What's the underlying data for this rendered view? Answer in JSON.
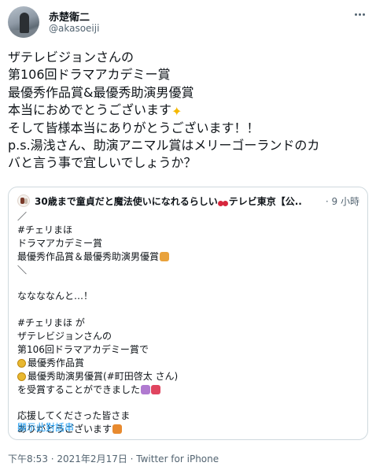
{
  "tweet": {
    "author_name": "赤楚衛二",
    "author_handle": "@akasoeiji",
    "text_lines": [
      "ザテレビジョンさんの",
      "第106回ドラマアカデミー賞",
      "最優秀作品賞&最優秀助演男優賞",
      "本当におめでとうございます",
      "そして皆様本当にありがとうございます！！",
      "p.s.湯浅さん、助演アニマル賞はメリーゴーランドのカ",
      "バと言う事で宜しいでしょうか？"
    ],
    "footer": "下午8:53 · 2021年2月17日 · Twitter for iPhone"
  },
  "quote": {
    "title_prefix": "30歳まで童貞だと魔法使いになれるらしい",
    "title_suffix": "テレビ東京【公...",
    "time": "· 9 小時",
    "lines": [
      "／",
      "#チェリまほ",
      "ドラマアカデミー賞",
      "最優秀作品賞＆最優秀助演男優賞",
      "＼",
      "",
      "ななななんと…！",
      "",
      "#チェリまほ が",
      "ザテレビジョンさんの",
      "第106回ドラマアカデミー賞で",
      "最優秀作品賞",
      "最優秀助演男優賞(#町田啓太 さん)",
      "を受賞することができました",
      "",
      "応援してくださった皆さま",
      "ありがとうございます"
    ],
    "show_thread": "顯示此對話串"
  },
  "icons": {
    "more": "more-horizontal-icon",
    "cherry": "cherry-emoji-icon",
    "sparkles": "sparkles-emoji-icon",
    "medal": "medal-emoji-icon",
    "party": "party-popper-emoji-icon",
    "bouquet": "bouquet-emoji-icon",
    "cheer": "cheering-emoji-icon"
  },
  "colors": {
    "text": "#0f1419",
    "muted": "#536471",
    "link": "#1d9bf0",
    "border": "#cfd9de"
  }
}
